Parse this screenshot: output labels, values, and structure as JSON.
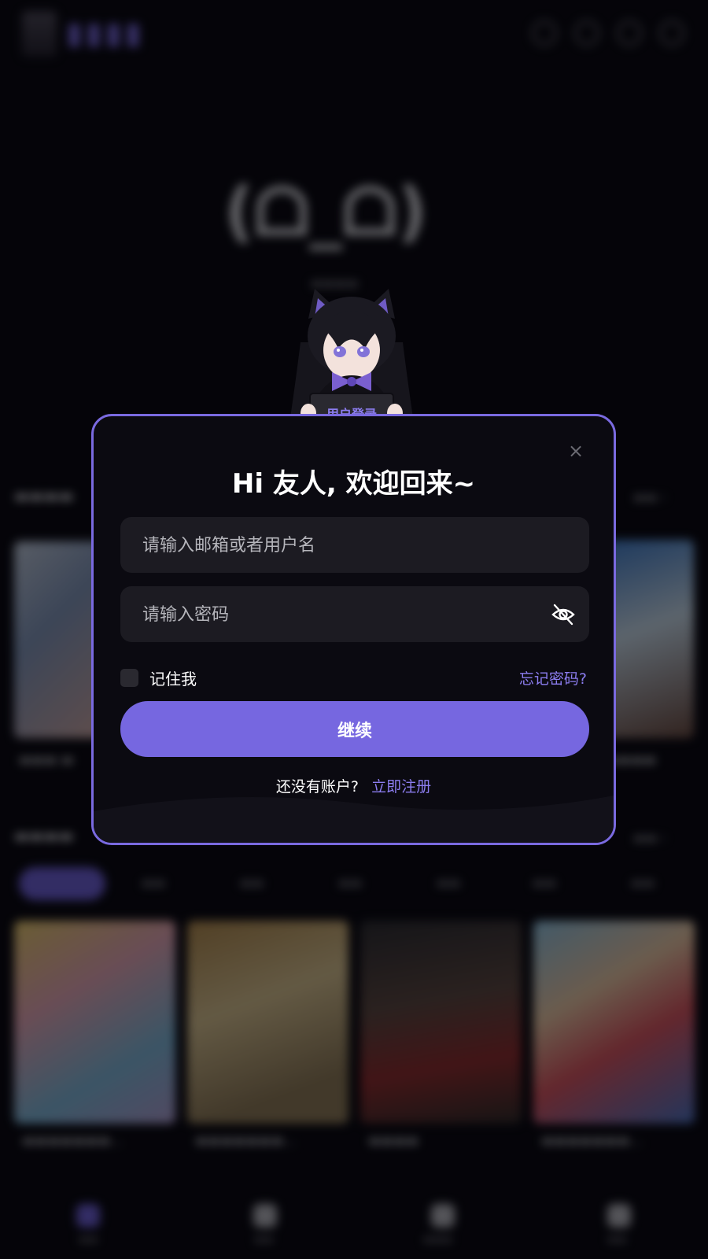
{
  "modal": {
    "close_glyph": "×",
    "title": "Hi 友人, 欢迎回来~",
    "username_placeholder": "请输入邮箱或者用户名",
    "password_placeholder": "请输入密码",
    "password_toggle_icon": "eye-off-icon",
    "remember_label": "记住我",
    "forgot_link": "忘记密码?",
    "continue_button": "继续",
    "signup_prompt": "还没有账户?",
    "signup_link": "立即注册",
    "mascot_sign_text": "用户登录"
  },
  "colors": {
    "accent": "#7667e0",
    "link": "#8c7df0",
    "modal_bg": "#0b0a11",
    "field_bg": "#1c1b22",
    "page_bg": "#07060c"
  }
}
